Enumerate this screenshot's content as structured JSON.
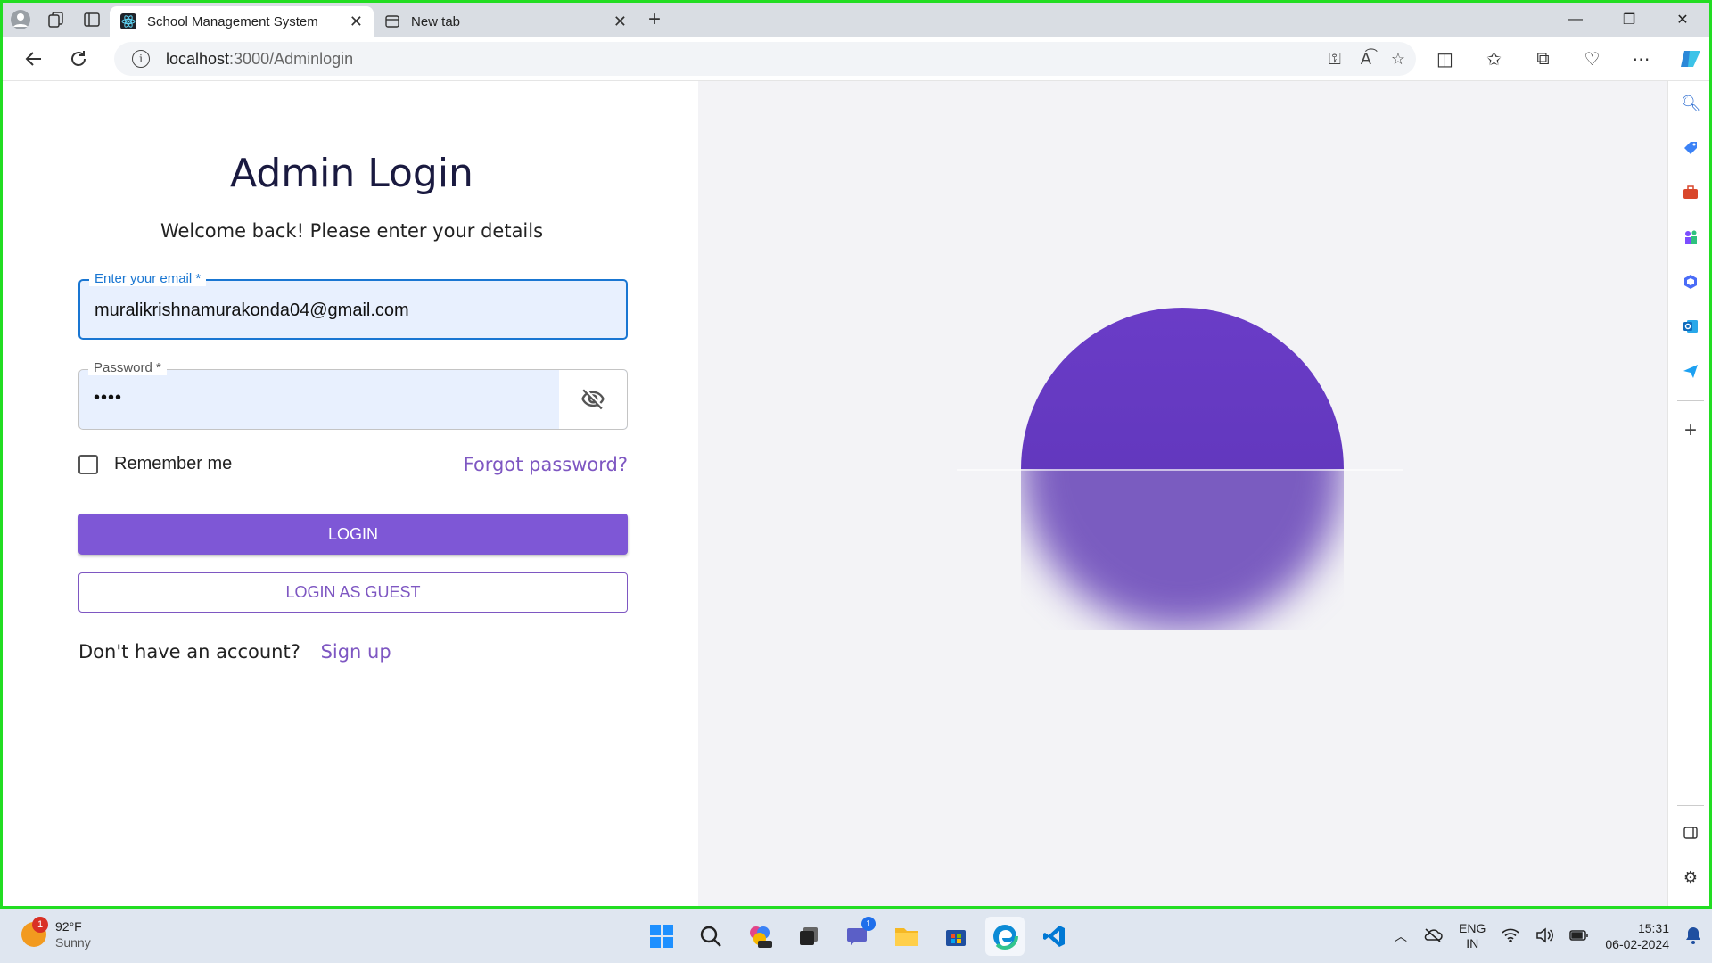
{
  "browser": {
    "tabs": [
      {
        "title": "School Management System",
        "active": true
      },
      {
        "title": "New tab",
        "active": false
      }
    ],
    "url_host": "localhost",
    "url_path": ":3000/Adminlogin"
  },
  "login": {
    "title": "Admin Login",
    "subtitle": "Welcome back! Please enter your details",
    "email_label": "Enter your email *",
    "email_value": "muralikrishnamurakonda04@gmail.com",
    "password_label": "Password *",
    "password_value": "••••",
    "remember_label": "Remember me",
    "forgot_label": "Forgot password?",
    "login_button": "LOGIN",
    "guest_button": "LOGIN AS GUEST",
    "signup_prompt": "Don't have an account?",
    "signup_link": "Sign up"
  },
  "colors": {
    "accent": "#7e57c2",
    "button": "#7e57d6",
    "focus": "#1976d2",
    "frame": "#22dd22"
  },
  "taskbar": {
    "weather_temp": "92°F",
    "weather_cond": "Sunny",
    "weather_badge": "1",
    "chat_badge": "1",
    "lang_line1": "ENG",
    "lang_line2": "IN",
    "time": "15:31",
    "date": "06-02-2024"
  }
}
